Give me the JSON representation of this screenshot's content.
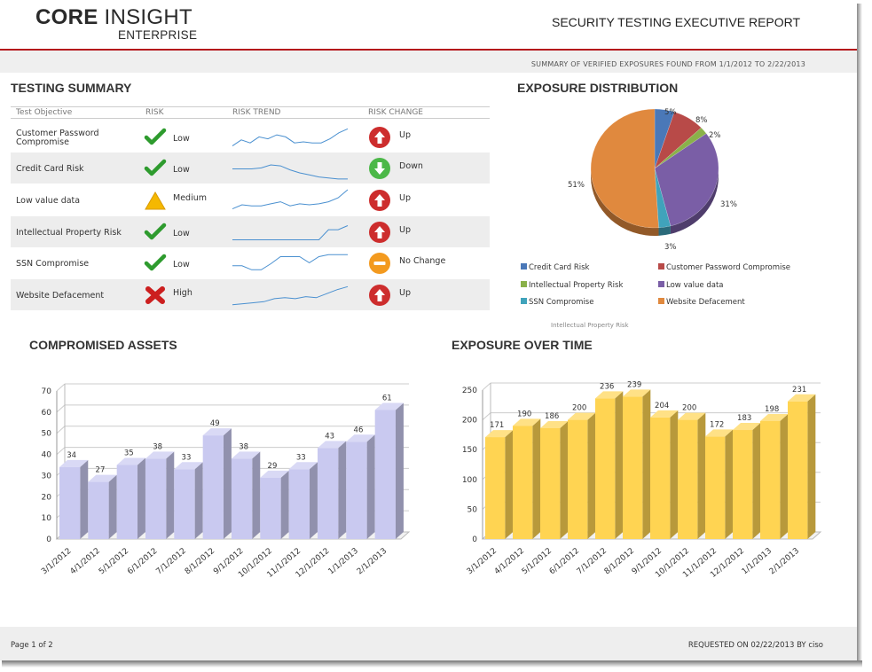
{
  "header": {
    "brand_bold": "CORE",
    "brand_light": "INSIGHT",
    "brand_sub": "ENTERPRISE",
    "title": "SECURITY TESTING EXECUTIVE REPORT",
    "summary_line": "SUMMARY OF VERIFIED EXPOSURES FOUND FROM 1/1/2012 TO 2/22/2013"
  },
  "testing_summary": {
    "title": "TESTING SUMMARY",
    "columns": [
      "Test Objective",
      "RISK",
      "RISK TREND",
      "RISK CHANGE"
    ],
    "rows": [
      {
        "objective": "Customer Password Compromise",
        "risk": "Low",
        "risk_icon": "check-icon",
        "change": "Up",
        "change_icon": "arrow-up-icon",
        "trend": [
          3,
          9,
          6,
          12,
          10,
          14,
          12,
          6,
          7,
          6,
          6,
          10,
          16,
          20
        ]
      },
      {
        "objective": "Credit Card Risk",
        "risk": "Low",
        "risk_icon": "check-icon",
        "change": "Down",
        "change_icon": "arrow-down-icon",
        "trend": [
          11,
          11,
          11,
          12,
          15,
          14,
          10,
          7,
          5,
          3,
          2,
          1,
          1
        ]
      },
      {
        "objective": "Low value data",
        "risk": "Medium",
        "risk_icon": "warning-icon",
        "change": "Up",
        "change_icon": "arrow-up-icon",
        "trend": [
          3,
          7,
          6,
          6,
          8,
          10,
          6,
          8,
          7,
          8,
          10,
          14,
          22
        ]
      },
      {
        "objective": "Intellectual Property Risk",
        "risk": "Low",
        "risk_icon": "check-icon",
        "change": "Up",
        "change_icon": "arrow-up-icon",
        "trend": [
          4,
          4,
          4,
          4,
          4,
          4,
          4,
          4,
          4,
          4,
          14,
          14,
          18
        ]
      },
      {
        "objective": "SSN Compromise",
        "risk": "Low",
        "risk_icon": "check-icon",
        "change": "No Change",
        "change_icon": "minus-icon",
        "trend": [
          9,
          9,
          5,
          5,
          11,
          18,
          18,
          18,
          12,
          18,
          20,
          20,
          20
        ]
      },
      {
        "objective": "Website Defacement",
        "risk": "High",
        "risk_icon": "cross-icon",
        "change": "Up",
        "change_icon": "arrow-up-icon",
        "trend": [
          2,
          3,
          4,
          5,
          8,
          9,
          8,
          10,
          9,
          13,
          17,
          20
        ]
      }
    ]
  },
  "exposure_distribution": {
    "title": "EXPOSURE DISTRIBUTION",
    "caption": "Intellectual Property Risk",
    "legend": [
      {
        "label": "Credit Card Risk",
        "color": "#4a78b8"
      },
      {
        "label": "Customer Password Compromise",
        "color": "#b84a48"
      },
      {
        "label": "Intellectual Property Risk",
        "color": "#8ab14a"
      },
      {
        "label": "Low value data",
        "color": "#7a5ea6"
      },
      {
        "label": "SSN Compromise",
        "color": "#40a3bb"
      },
      {
        "label": "Website Defacement",
        "color": "#e0893e"
      }
    ]
  },
  "compromised_assets": {
    "title": "COMPROMISED ASSETS"
  },
  "exposure_over_time": {
    "title": "EXPOSURE OVER TIME"
  },
  "chart_data": [
    {
      "type": "pie",
      "title": "EXPOSURE DISTRIBUTION",
      "labels": [
        "Credit Card Risk",
        "Customer Password Compromise",
        "Intellectual Property Risk",
        "Low value data",
        "SSN Compromise",
        "Website Defacement"
      ],
      "values": [
        5,
        8,
        2,
        31,
        3,
        51
      ],
      "value_labels": [
        "5%",
        "8%",
        "2%",
        "31%",
        "3%",
        "51%"
      ],
      "colors": [
        "#4a78b8",
        "#b84a48",
        "#8ab14a",
        "#7a5ea6",
        "#40a3bb",
        "#e0893e"
      ],
      "legend": "bottom"
    },
    {
      "type": "bar",
      "title": "COMPROMISED ASSETS",
      "categories": [
        "3/1/2012",
        "4/1/2012",
        "5/1/2012",
        "6/1/2012",
        "7/1/2012",
        "8/1/2012",
        "9/1/2012",
        "10/1/2012",
        "11/1/2012",
        "12/1/2012",
        "1/1/2013",
        "2/1/2013"
      ],
      "values": [
        34,
        27,
        35,
        38,
        33,
        49,
        38,
        29,
        33,
        43,
        46,
        61
      ],
      "ylim": [
        0,
        70
      ],
      "yticks": [
        0,
        10,
        20,
        30,
        40,
        50,
        60,
        70
      ],
      "color": "#c9c9f0",
      "grid": true
    },
    {
      "type": "bar",
      "title": "EXPOSURE OVER TIME",
      "categories": [
        "3/1/2012",
        "4/1/2012",
        "5/1/2012",
        "6/1/2012",
        "7/1/2012",
        "8/1/2012",
        "9/1/2012",
        "10/1/2012",
        "11/1/2012",
        "12/1/2012",
        "1/1/2013",
        "2/1/2013"
      ],
      "values": [
        171,
        190,
        186,
        200,
        236,
        239,
        204,
        200,
        172,
        183,
        198,
        231
      ],
      "ylim": [
        0,
        250
      ],
      "yticks": [
        0,
        50,
        100,
        150,
        200,
        250
      ],
      "color": "#ffd452",
      "grid": true
    }
  ],
  "footer": {
    "page": "Page 1 of 2",
    "requested": "REQUESTED ON 02/22/2013 BY ciso"
  }
}
